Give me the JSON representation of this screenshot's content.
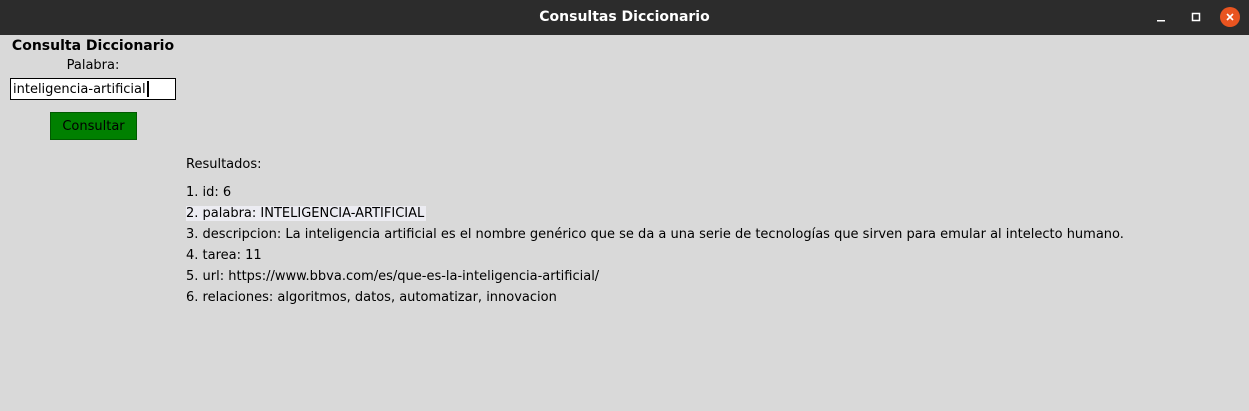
{
  "window": {
    "title": "Consultas Diccionario",
    "controls": [
      "minimize-icon",
      "maximize-icon",
      "close-icon"
    ],
    "close_color": "#e95420"
  },
  "form": {
    "heading": "Consulta Diccionario",
    "word_label": "Palabra:",
    "word_value": "inteligencia-artificial",
    "query_button": "Consultar",
    "button_color": "#008000"
  },
  "results": {
    "heading": "Resultados:",
    "items": [
      "1. id: 6",
      "2. palabra: INTELIGENCIA-ARTIFICIAL",
      "3. descripcion: La inteligencia artificial es el nombre genérico que se da a una serie de tecnologías que sirven para emular al intelecto humano.",
      "4. tarea: 11",
      "5. url: https://www.bbva.com/es/que-es-la-inteligencia-artificial/",
      "6. relaciones: algoritmos, datos, automatizar, innovacion"
    ],
    "selected_index": 1
  }
}
